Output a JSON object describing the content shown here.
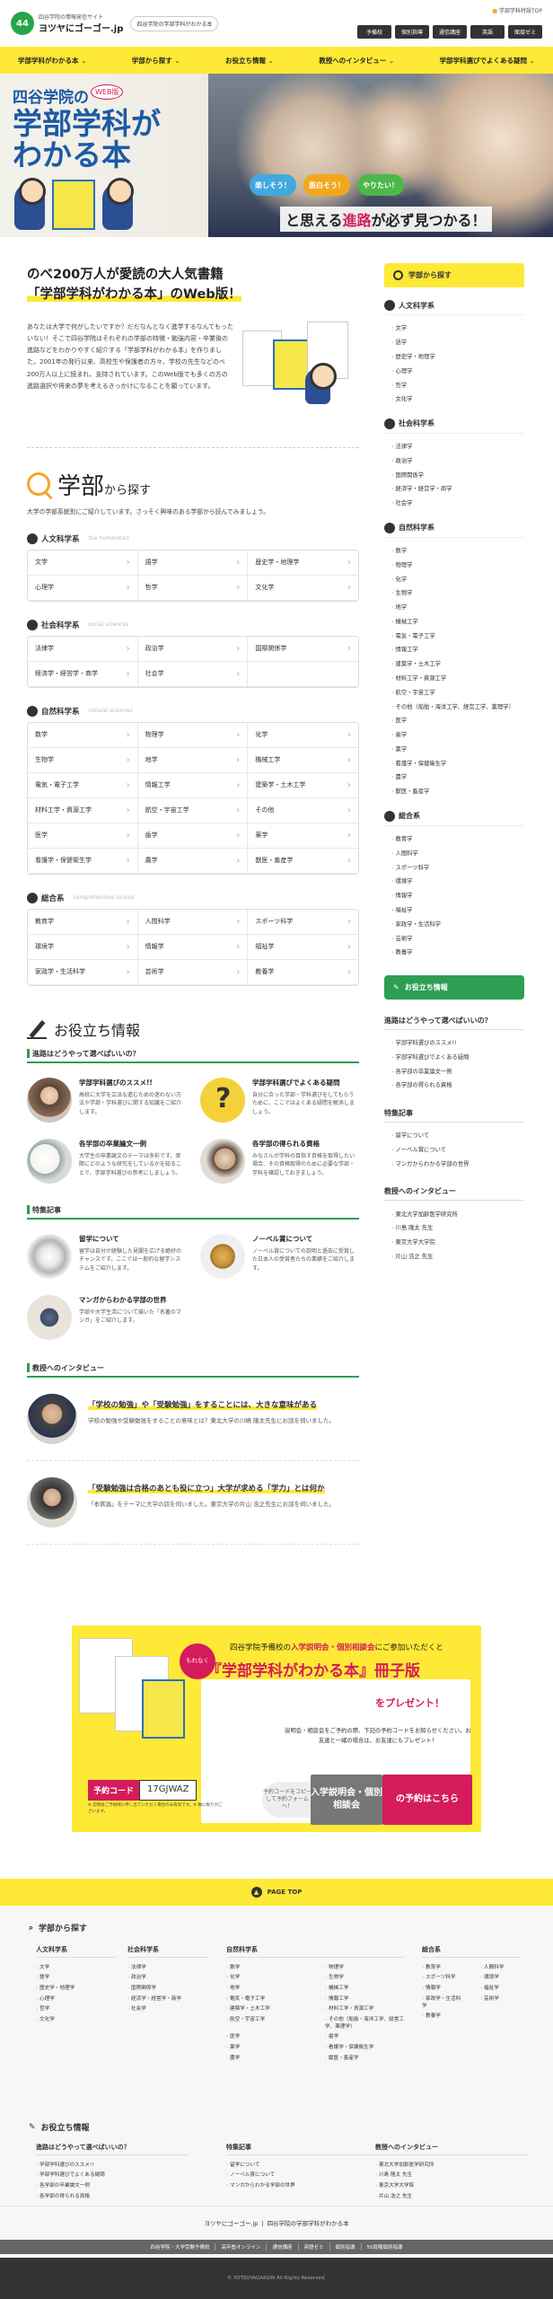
{
  "header": {
    "site_sub": "四谷学院の情報発信サイト",
    "site_name": "ヨツヤにゴーゴー.jp",
    "tag": "四谷学院の学部学科がわかる本",
    "top_link": "学部学科特設TOP",
    "tabs": [
      "予備校",
      "個別指導",
      "通信講座",
      "英語",
      "面接ゼミ"
    ]
  },
  "nav": [
    "学部学科がわかる本",
    "学部から探す",
    "お役立ち情報",
    "教授へのインタビュー",
    "学部学科選びでよくある疑問"
  ],
  "hero": {
    "l1": "四谷学院の",
    "badge": "WEB版",
    "l2": "学部学科が",
    "l3": "わかる本",
    "bubbles": [
      "楽しそう！",
      "面白そう！",
      "やりたい！"
    ],
    "tag_pre": "と思える",
    "tag_em": "進路",
    "tag_post": "が必ず見つかる！"
  },
  "intro": {
    "h1": "のべ200万人が愛読の大人気書籍",
    "h2": "「学部学科がわかる本」のWeb版！",
    "body": "あなたは大学で何がしたいですか？だだなんとなく進学するなんてもったいない！そこで四谷学院はそれぞれの学部の特徴・勉強内容・卒業後の進路などをわかりやすく紹介する「学部学科がわかる本」を作りました。2001年の発行以来、高校生や保護者の方々、学校の先生などのべ200万人以上に読まれ、支持されています。このWeb版でも多くの方の進路選択や将来の夢を考えるきっかけになることを願っています。"
  },
  "search": {
    "title_main": "学部",
    "title_sub": "から探す",
    "desc": "大学の学部系統別にご紹介しています。さっそく興味のある学部から読んでみましょう。",
    "categories": [
      {
        "name": "人文科学系",
        "en": "the humanities",
        "items": [
          "文学",
          "語学",
          "歴史学・地理学",
          "心理学",
          "哲学",
          "文化学"
        ]
      },
      {
        "name": "社会科学系",
        "en": "social sciences",
        "items": [
          "法律学",
          "政治学",
          "国際関係学",
          "経済学・経営学・商学",
          "社会学",
          ""
        ]
      },
      {
        "name": "自然科学系",
        "en": "natural sciences",
        "items": [
          "数学",
          "物理学",
          "化学",
          "生物学",
          "地学",
          "機械工学",
          "電気・電子工学",
          "情報工学",
          "建築学・土木工学",
          "材料工学・資源工学",
          "航空・宇宙工学",
          "その他",
          "医学",
          "歯学",
          "薬学",
          "看護学・保健衛生学",
          "農学",
          "獣医・畜産学"
        ]
      },
      {
        "name": "総合系",
        "en": "comprehensive course",
        "items": [
          "教育学",
          "人間科学",
          "スポーツ科学",
          "環境学",
          "情報学",
          "福祉学",
          "家政学・生活科学",
          "芸術学",
          "教養学"
        ]
      }
    ]
  },
  "useful": {
    "title": "お役立ち情報",
    "sub1": "進路はどうやって選べばいいの？",
    "cards1": [
      {
        "t": "学部学科選びのススメ!!",
        "d": "高校に大学を立派な進むための迷わない方法や学部・学科選びに関する知識をご紹介します。"
      },
      {
        "t": "学部学科選びでよくある疑問",
        "d": "自分に合った学部・学科選びをしてもらうために、ここではよくある疑問を解消しましょう。"
      },
      {
        "t": "各学部の卒業論文一例",
        "d": "大学生の卒業論文のテーマは多彩です。実際にどのような研究をしているかを知ることで、学部学科選びの参考にしましょう。"
      },
      {
        "t": "各学部の得られる資格",
        "d": "みなさんが学科の目指す資格を取得したい場合、その資格取得のために必要な学部・学科を確認しておきましょう。"
      }
    ],
    "sub2": "特集記事",
    "cards2": [
      {
        "t": "留学について",
        "d": "留学は自分が経験した見聞を広げる絶好のチャンスです。ここでは一般的な留学システムをご紹介します。"
      },
      {
        "t": "ノーベル賞について",
        "d": "ノーベル賞についての説明と過去に受賞した日本人の受賞者たちの業績をご紹介します。"
      },
      {
        "t": "マンガからわかる学部の世界",
        "d": "学部や大学生活について描いた「名著のマンガ」をご紹介します。"
      }
    ],
    "sub3": "教授へのインタビュー",
    "interviews": [
      {
        "t": "「学校の勉強」や「受験勉強」をすることには、大きな意味がある",
        "d": "学校の勉強や受験勉強をすることの意味とは？東北大学の川嶋 隆太先生にお話を伺いました。"
      },
      {
        "t": "「受験勉強は合格のあとも役に立つ」大学が求める「学力」とは何か",
        "d": "「本質論」をテーマに大学の話を伺いました。東京大学の片山 浩之先生にお話を伺いました。"
      }
    ]
  },
  "sidebar": {
    "search_head": "学部から探す",
    "cats": [
      {
        "name": "人文科学系",
        "items": [
          "文学",
          "語学",
          "歴史学・地理学",
          "心理学",
          "哲学",
          "文化学"
        ]
      },
      {
        "name": "社会科学系",
        "items": [
          "法律学",
          "政治学",
          "国際関係学",
          "経済学・経営学・商学",
          "社会学"
        ]
      },
      {
        "name": "自然科学系",
        "items": [
          "数学",
          "物理学",
          "化学",
          "生物学",
          "地学",
          "機械工学",
          "電気・電子工学",
          "情報工学",
          "建築学・土木工学",
          "材料工学・資源工学",
          "航空・宇宙工学",
          "その他（船舶・海洋工学、経営工学、薬理学）",
          "医学",
          "歯学",
          "薬学",
          "看護学・保健衛生学",
          "農学",
          "獣医・畜産学"
        ]
      },
      {
        "name": "総合系",
        "items": [
          "教育学",
          "人間科学",
          "スポーツ科学",
          "環境学",
          "情報学",
          "福祉学",
          "家政学・生活科学",
          "芸術学",
          "教養学"
        ]
      }
    ],
    "useful_head": "お役立ち情報",
    "u1": "進路はどうやって選べばいいの？",
    "u1_items": [
      "学部学科選びのススメ!!",
      "学部学科選びでよくある疑問",
      "各学部の卒業論文一例",
      "各学部の得られる資格"
    ],
    "u2": "特集記事",
    "u2_items": [
      "留学について",
      "ノーベル賞について",
      "マンガからわかる学部の世界"
    ],
    "u3": "教授へのインタビュー",
    "u3_items": [
      "東北大学加齢医学研究所",
      "川島 隆太 先生",
      "東京大学大学院",
      "片山 浩之 先生"
    ]
  },
  "campaign": {
    "badge": "もれなく",
    "l1_pre": "四谷学院予備校の",
    "l1_em": "入学説明会・個別相談会",
    "l1_post": "にご参加いただくと",
    "l2": "『学部学科がわかる本』冊子版",
    "l3": "をプレゼント！",
    "desc": "説明会・相談会をご予約の際、下記の予約コードをお知らせください。お友達と一緒の場合は、お友達にもプレゼント！",
    "code_label": "予約コード",
    "code": "17GJWAZ",
    "note": "※ 説明会ご予約時に申し出ていただく場合のみ有効です。※ 数に限りがございます。",
    "copy": "予約コードをコピーして予約フォームへ！",
    "btn_a": "入学説明会・個別相談会",
    "btn_b": "の予約はこちら"
  },
  "pagetop": "PAGE TOP",
  "footer": {
    "search_h": "学部から探す",
    "useful_h": "お役立ち情報",
    "meta": [
      "ヨツヤにゴーゴー.jp",
      "四谷学院の学部学科がわかる本"
    ],
    "links": [
      "四谷学院・大学受験予備校",
      "高卒塾オンライン",
      "通信講座",
      "英語ゼミ",
      "個別指導",
      "55段階個別指導"
    ],
    "copyright": "© YOTSUYAGAKUIN All Rights Reserved."
  }
}
